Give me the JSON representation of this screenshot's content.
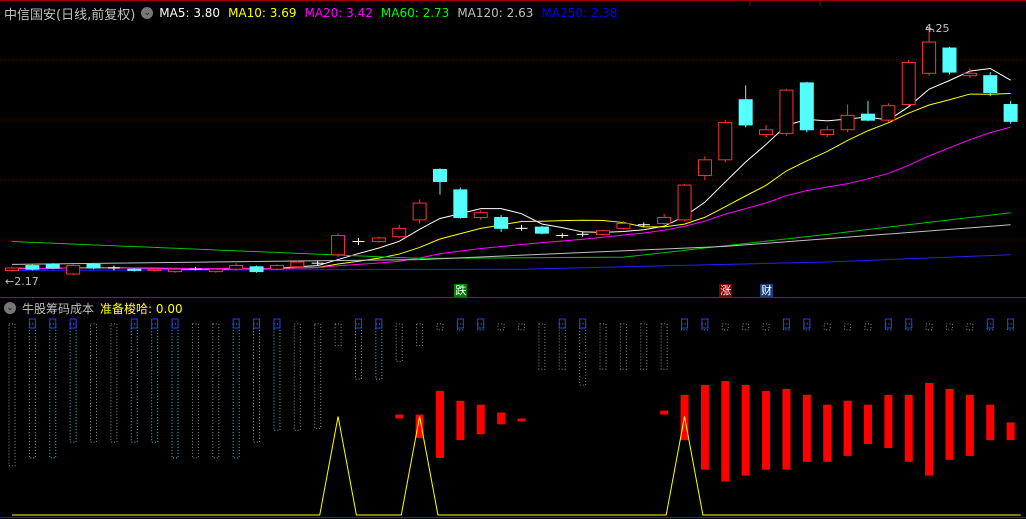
{
  "main_header": {
    "title": "中信国安(日线,前复权)",
    "ma": [
      {
        "label": "MA5: 3.80",
        "color": "#ffffff"
      },
      {
        "label": "MA10: 3.69",
        "color": "#ffff00"
      },
      {
        "label": "MA20: 3.42",
        "color": "#ff00ff"
      },
      {
        "label": "MA60: 2.73",
        "color": "#00ff00"
      },
      {
        "label": "MA120: 2.63",
        "color": "#c0c0c0"
      },
      {
        "label": "MA250: 2.38",
        "color": "#0000ff"
      }
    ]
  },
  "price_labels": {
    "high": "4.25",
    "low": "←2.17"
  },
  "markers": [
    {
      "text": "跌",
      "index": 22,
      "bg": "#008000"
    },
    {
      "text": "涨",
      "index": 35,
      "bg": "#800000"
    },
    {
      "text": "财",
      "index": 37,
      "bg": "#1a3f7a"
    }
  ],
  "sub_header": {
    "title": "牛股筹码成本",
    "value_label": "准备梭哈: 0.00"
  },
  "chart_data": {
    "type": "candlestick",
    "price_range": [
      2.13,
      4.25
    ],
    "candles": [
      [
        2.25,
        2.27,
        2.28,
        2.24
      ],
      [
        2.29,
        2.26,
        2.3,
        2.25
      ],
      [
        2.3,
        2.27,
        2.31,
        2.26
      ],
      [
        2.22,
        2.29,
        2.3,
        2.21
      ],
      [
        2.3,
        2.27,
        2.31,
        2.26
      ],
      [
        2.27,
        2.27,
        2.29,
        2.25
      ],
      [
        2.26,
        2.25,
        2.27,
        2.24
      ],
      [
        2.25,
        2.26,
        2.27,
        2.24
      ],
      [
        2.24,
        2.26,
        2.27,
        2.23
      ],
      [
        2.26,
        2.26,
        2.28,
        2.25
      ],
      [
        2.24,
        2.26,
        2.27,
        2.23
      ],
      [
        2.26,
        2.29,
        2.31,
        2.25
      ],
      [
        2.28,
        2.24,
        2.29,
        2.23
      ],
      [
        2.26,
        2.29,
        2.3,
        2.25
      ],
      [
        2.28,
        2.32,
        2.33,
        2.27
      ],
      [
        2.31,
        2.31,
        2.33,
        2.29
      ],
      [
        2.38,
        2.54,
        2.56,
        2.36
      ],
      [
        2.49,
        2.49,
        2.52,
        2.46
      ],
      [
        2.49,
        2.52,
        2.53,
        2.48
      ],
      [
        2.53,
        2.6,
        2.63,
        2.52
      ],
      [
        2.67,
        2.81,
        2.84,
        2.64
      ],
      [
        3.09,
        2.99,
        3.1,
        2.88
      ],
      [
        2.92,
        2.69,
        2.94,
        2.68
      ],
      [
        2.69,
        2.73,
        2.75,
        2.67
      ],
      [
        2.69,
        2.6,
        2.71,
        2.57
      ],
      [
        2.6,
        2.6,
        2.63,
        2.58
      ],
      [
        2.61,
        2.56,
        2.62,
        2.55
      ],
      [
        2.54,
        2.54,
        2.56,
        2.52
      ],
      [
        2.55,
        2.55,
        2.57,
        2.53
      ],
      [
        2.55,
        2.58,
        2.59,
        2.54
      ],
      [
        2.6,
        2.64,
        2.66,
        2.59
      ],
      [
        2.63,
        2.63,
        2.65,
        2.61
      ],
      [
        2.64,
        2.69,
        2.72,
        2.63
      ],
      [
        2.67,
        2.96,
        2.97,
        2.66
      ],
      [
        3.04,
        3.17,
        3.2,
        3.0
      ],
      [
        3.17,
        3.48,
        3.5,
        3.15
      ],
      [
        3.67,
        3.46,
        3.79,
        3.44
      ],
      [
        3.38,
        3.42,
        3.46,
        3.36
      ],
      [
        3.39,
        3.75,
        3.76,
        3.37
      ],
      [
        3.81,
        3.42,
        3.82,
        3.4
      ],
      [
        3.38,
        3.42,
        3.45,
        3.36
      ],
      [
        3.42,
        3.54,
        3.63,
        3.4
      ],
      [
        3.55,
        3.5,
        3.66,
        3.49
      ],
      [
        3.5,
        3.62,
        3.64,
        3.48
      ],
      [
        3.63,
        3.98,
        4.0,
        3.62
      ],
      [
        3.89,
        4.15,
        4.25,
        3.87
      ],
      [
        4.1,
        3.9,
        4.11,
        3.88
      ],
      [
        3.87,
        3.89,
        3.93,
        3.85
      ],
      [
        3.87,
        3.73,
        3.9,
        3.7
      ],
      [
        3.63,
        3.49,
        3.66,
        3.47
      ]
    ],
    "candle_fields": [
      "open",
      "close",
      "high",
      "low"
    ],
    "ma_lines": [
      {
        "name": "MA5",
        "color": "#ffffff",
        "period": 5
      },
      {
        "name": "MA10",
        "color": "#ffff00",
        "period": 10
      },
      {
        "name": "MA20",
        "color": "#ff00ff",
        "period": 20
      },
      {
        "name": "MA60",
        "color": "#00c000",
        "points": [
          [
            0,
            2.49
          ],
          [
            20,
            2.35
          ],
          [
            30,
            2.36
          ],
          [
            40,
            2.55
          ],
          [
            49,
            2.73
          ]
        ]
      },
      {
        "name": "MA120",
        "color": "#c0c0c0",
        "points": [
          [
            0,
            2.3
          ],
          [
            20,
            2.34
          ],
          [
            35,
            2.45
          ],
          [
            49,
            2.63
          ]
        ]
      },
      {
        "name": "MA250",
        "color": "#2020ff",
        "points": [
          [
            0,
            2.25
          ],
          [
            25,
            2.26
          ],
          [
            40,
            2.32
          ],
          [
            49,
            2.38
          ]
        ]
      }
    ],
    "indicator": {
      "range": [
        0,
        100
      ],
      "chip_bottom": [
        25,
        29,
        29,
        37,
        37,
        37,
        37,
        37,
        29,
        29,
        29,
        29,
        37,
        43,
        43,
        44,
        86,
        69,
        69,
        78,
        86,
        94,
        94,
        94,
        94,
        94,
        74,
        74,
        66,
        74,
        74,
        74,
        74,
        94,
        94,
        94,
        94,
        94,
        94,
        94,
        94,
        94,
        94,
        94,
        94,
        94,
        94,
        94,
        94,
        94
      ],
      "chip_highlight": [
        1,
        2,
        3,
        6,
        7,
        8,
        11,
        12,
        13,
        17,
        18
      ],
      "top_squares": [
        1,
        2,
        3,
        6,
        7,
        8,
        11,
        12,
        13,
        17,
        18,
        22,
        23,
        27,
        28,
        33,
        34,
        38,
        39,
        43,
        44,
        48,
        49
      ],
      "red_bars": [
        [
          19,
          51,
          49
        ],
        [
          20,
          51,
          39
        ],
        [
          21,
          63,
          29
        ],
        [
          22,
          58,
          38
        ],
        [
          23,
          56,
          41
        ],
        [
          24,
          52,
          46
        ],
        [
          25,
          49,
          48
        ],
        [
          32,
          53,
          51
        ],
        [
          33,
          61,
          38
        ],
        [
          34,
          66,
          23
        ],
        [
          35,
          68,
          17
        ],
        [
          36,
          66,
          20
        ],
        [
          37,
          63,
          23
        ],
        [
          38,
          64,
          23
        ],
        [
          39,
          61,
          27
        ],
        [
          40,
          56,
          27
        ],
        [
          41,
          58,
          30
        ],
        [
          42,
          56,
          36
        ],
        [
          43,
          61,
          34
        ],
        [
          44,
          61,
          27
        ],
        [
          45,
          67,
          20
        ],
        [
          46,
          64,
          28
        ],
        [
          47,
          61,
          30
        ],
        [
          48,
          56,
          38
        ],
        [
          49,
          47,
          38
        ]
      ],
      "signal_peaks": [
        [
          16,
          50
        ],
        [
          20,
          50
        ],
        [
          33,
          50
        ]
      ]
    }
  }
}
